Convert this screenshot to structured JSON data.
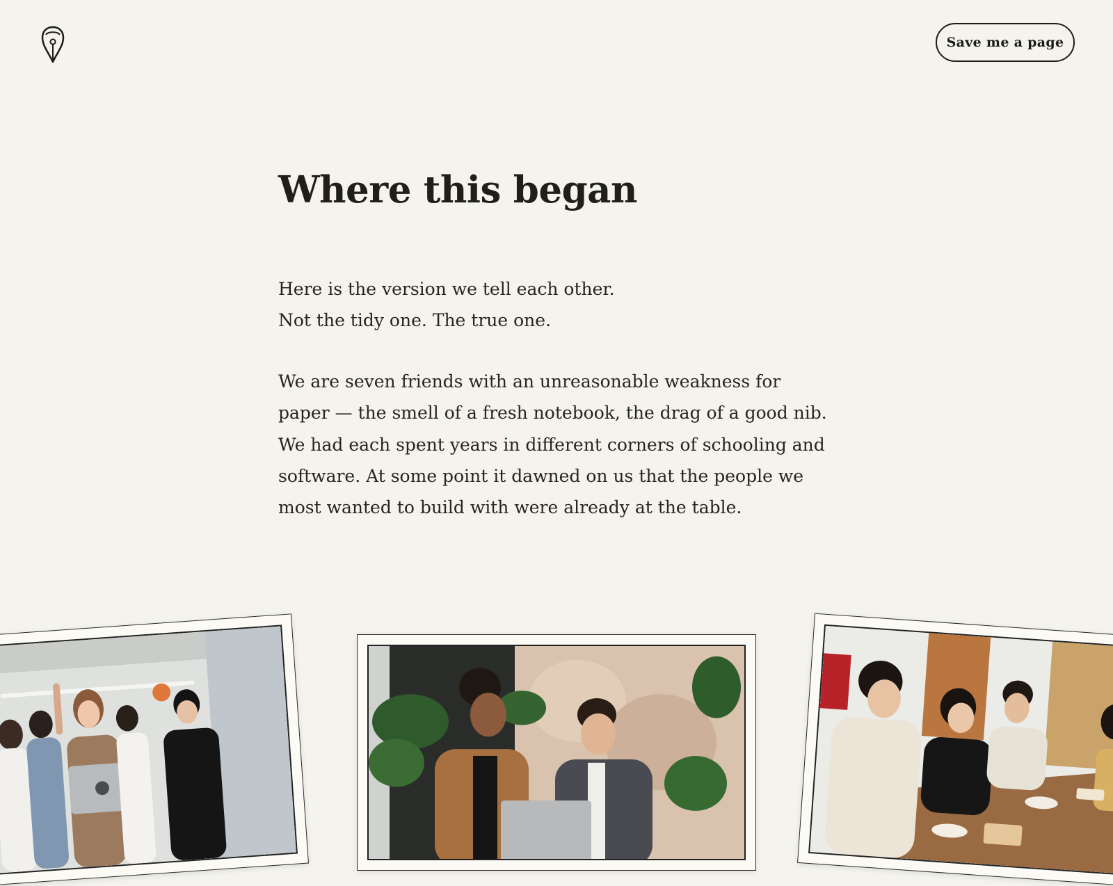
{
  "header": {
    "logo_icon": "fountain-pen-nib-icon",
    "cta_label": "Save me a page"
  },
  "main": {
    "title": "Where this began",
    "intro_lines": [
      "Here is the version we tell each other.",
      "Not the tidy one. The true one."
    ],
    "story": "We are seven friends with an unreasonable weakness for paper — the smell of a fresh notebook, the drag of a good nib. We had each spent years in different corners of schooling and software. At some point it dawned on us that the people we most wanted to build with were already at the table."
  },
  "photos": [
    {
      "scene": "team-celebrating-with-laptop"
    },
    {
      "scene": "two-colleagues-at-laptop"
    },
    {
      "scene": "friends-eating-at-table"
    }
  ],
  "colors": {
    "background": "#f4f4ed",
    "text": "#26241f",
    "frame": "#fbfaf5",
    "outline": "#1c1b17"
  }
}
